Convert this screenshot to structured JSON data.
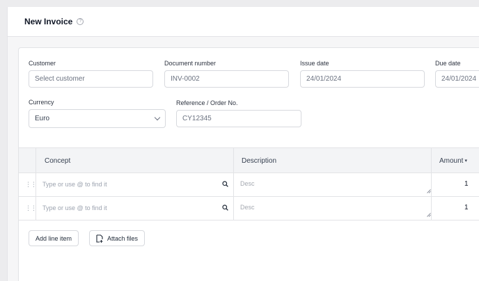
{
  "header": {
    "title": "New Invoice",
    "help_icon": "question-circle-icon"
  },
  "form": {
    "customer": {
      "label": "Customer",
      "placeholder": "Select customer"
    },
    "document_number": {
      "label": "Document number",
      "value": "INV-0002"
    },
    "issue_date": {
      "label": "Issue date",
      "value": "24/01/2024"
    },
    "due_date": {
      "label": "Due date",
      "value": "24/01/2024"
    },
    "currency": {
      "label": "Currency",
      "value": "Euro"
    },
    "reference": {
      "label": "Reference / Order No.",
      "value": "CY12345"
    }
  },
  "table": {
    "columns": {
      "concept": "Concept",
      "description": "Description",
      "amount": "Amount"
    },
    "rows": [
      {
        "concept_placeholder": "Type or use @ to find it",
        "description_placeholder": "Desc",
        "amount": "1"
      },
      {
        "concept_placeholder": "Type or use @ to find it",
        "description_placeholder": "Desc",
        "amount": "1"
      }
    ]
  },
  "actions": {
    "add_line_item": "Add line item",
    "attach_files": "Attach files"
  }
}
